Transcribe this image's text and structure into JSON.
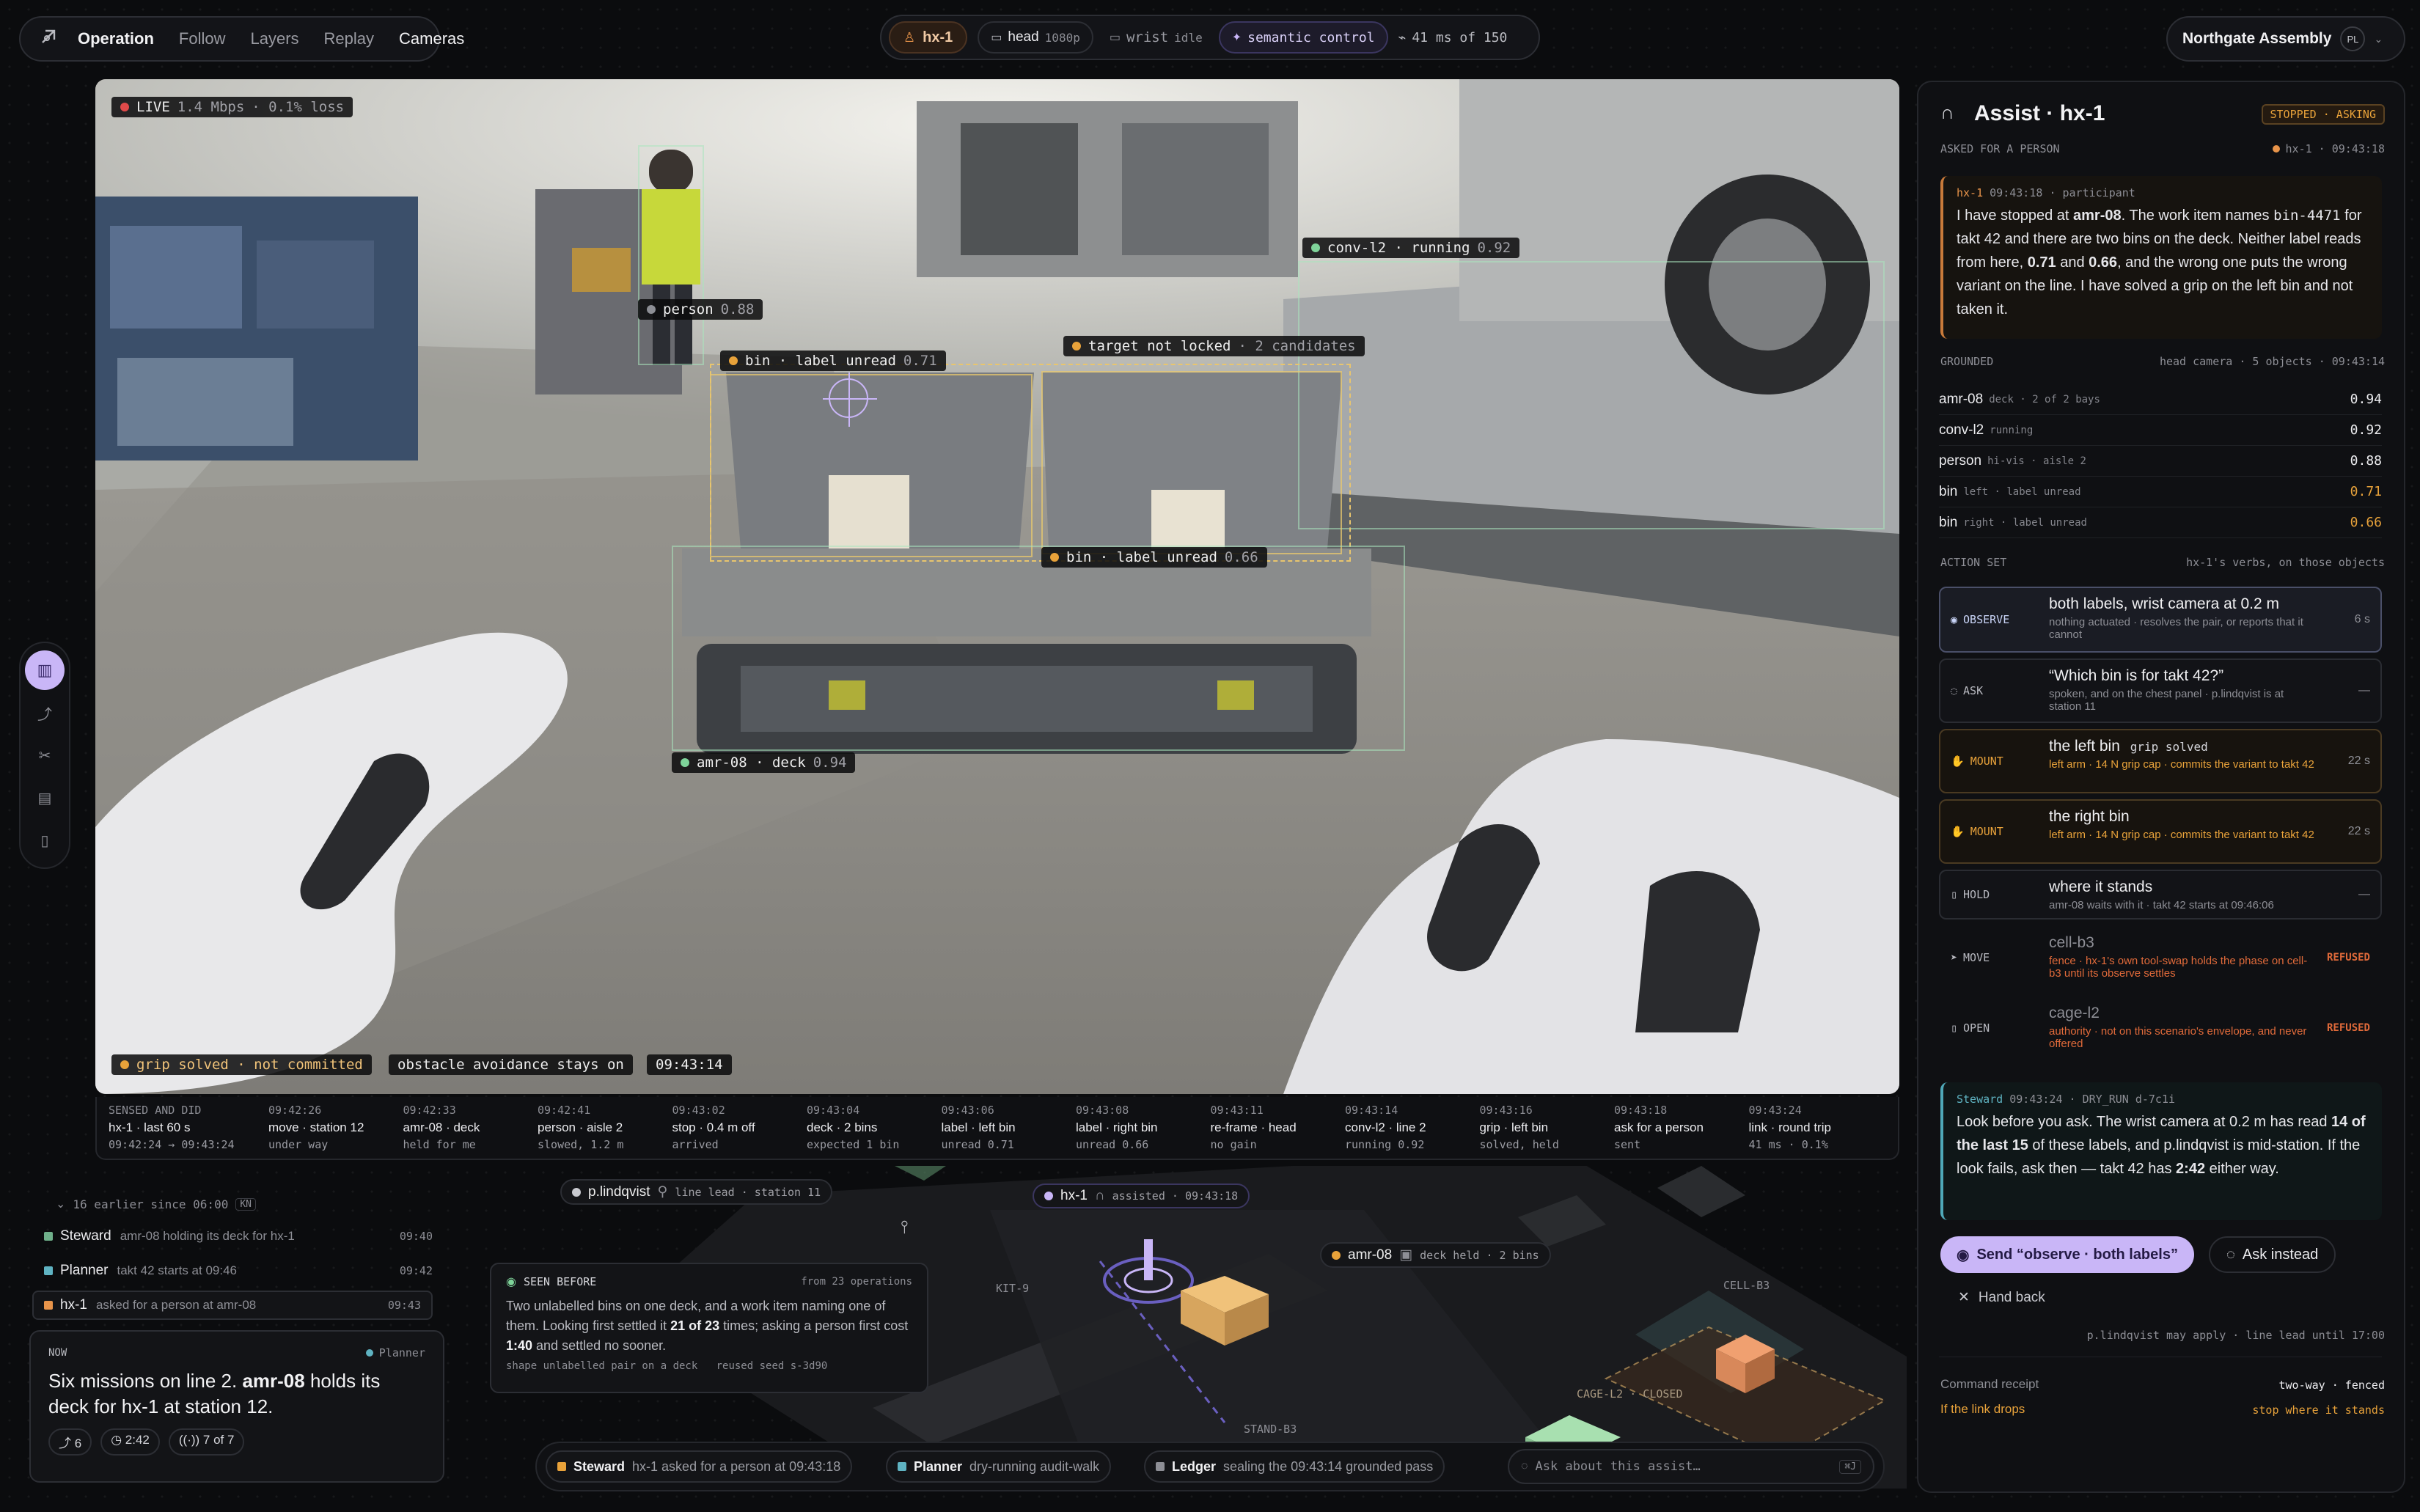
{
  "nav": {
    "items": [
      "Operation",
      "Follow",
      "Layers",
      "Replay",
      "Cameras"
    ]
  },
  "status": {
    "robot": "hx-1",
    "head": "head",
    "head_res": "1080p",
    "wrist": "wrist",
    "wrist_state": "idle",
    "control": "semantic control",
    "latency": "41 ms of 150"
  },
  "org": {
    "name": "Northgate Assembly",
    "initials": "PL"
  },
  "camera": {
    "live": "LIVE",
    "bitrate": "1.4 Mbps",
    "loss": "· 0.1% loss",
    "detections": {
      "person": {
        "label": "person",
        "conf": "0.88"
      },
      "conv": {
        "label": "conv-l2 · running",
        "conf": "0.92"
      },
      "target": {
        "label": "target not locked",
        "note": "· 2 candidates"
      },
      "bin_left": {
        "label": "bin · label unread",
        "conf": "0.71"
      },
      "bin_right": {
        "label": "bin · label unread",
        "conf": "0.66"
      },
      "amr": {
        "label": "amr-08 · deck",
        "conf": "0.94"
      }
    },
    "footer": {
      "grip": "grip solved · not committed",
      "obstacle": "obstacle avoidance stays on",
      "time": "09:43:14"
    }
  },
  "timeline": {
    "head_title": "SENSED AND DID",
    "head_sub": "hx-1 · last 60 s",
    "head_range": "09:42:24 → 09:43:24",
    "events": [
      {
        "t": "09:42:26",
        "a": "move · station 12",
        "b": "under way"
      },
      {
        "t": "09:42:33",
        "a": "amr-08 · deck",
        "b": "held for me"
      },
      {
        "t": "09:42:41",
        "a": "person · aisle 2",
        "b": "slowed, 1.2 m"
      },
      {
        "t": "09:43:02",
        "a": "stop · 0.4 m off",
        "b": "arrived"
      },
      {
        "t": "09:43:04",
        "a": "deck · 2 bins",
        "b": "expected 1 bin"
      },
      {
        "t": "09:43:06",
        "a": "label · left bin",
        "b": "unread 0.71"
      },
      {
        "t": "09:43:08",
        "a": "label · right bin",
        "b": "unread 0.66"
      },
      {
        "t": "09:43:11",
        "a": "re-frame · head",
        "b": "no gain"
      },
      {
        "t": "09:43:14",
        "a": "conv-l2 · line 2",
        "b": "running 0.92"
      },
      {
        "t": "09:43:16",
        "a": "grip · left bin",
        "b": "solved, held"
      },
      {
        "t": "09:43:18",
        "a": "ask for a person",
        "b": "sent"
      },
      {
        "t": "09:43:24",
        "a": "link · round trip",
        "b": "41 ms · 0.1%"
      }
    ]
  },
  "feed": {
    "earlier": "16 earlier since 06:00",
    "shortcut": "KN",
    "items": [
      {
        "who": "Steward",
        "text": "amr-08 holding its deck for hx-1",
        "time": "09:40",
        "color": "#6fb08a"
      },
      {
        "who": "Planner",
        "text": "takt 42 starts at 09:46",
        "time": "09:42",
        "color": "#5fb3c2"
      },
      {
        "who": "hx-1",
        "text": "asked for a person at amr-08",
        "time": "09:43",
        "color": "#e8944a"
      }
    ],
    "now": {
      "label": "NOW",
      "source": "Planner",
      "text_a": "Six missions on line 2. ",
      "bold": "amr-08",
      "text_b": " holds its deck for hx-1 at station 12.",
      "stat1": "6",
      "stat2": "2:42",
      "stat3": "7 of 7"
    }
  },
  "map": {
    "person": {
      "name": "p.lindqvist",
      "role": "line lead · station 11"
    },
    "robot": {
      "name": "hx-1",
      "state": "assisted · 09:43:18"
    },
    "amr": {
      "name": "amr-08",
      "detail": "deck held · 2 bins"
    },
    "zones": {
      "kit": "KIT-9",
      "cell": "CELL-B3",
      "cage": "CAGE-L2 · CLOSED",
      "stand": "STAND-B3"
    },
    "seen": {
      "title": "SEEN BEFORE",
      "from": "from 23 operations",
      "text_a": "Two unlabelled bins on one deck, and a work item naming one of them. Looking first settled it ",
      "b1": "21 of 23",
      "text_b": " times; asking a person first cost ",
      "b2": "1:40",
      "text_c": " and settled no sooner.",
      "shape": "shape unlabelled pair on a deck",
      "reused": "reused seed s-3d90"
    }
  },
  "bottom": {
    "chips": [
      {
        "who": "Steward",
        "text": "hx-1 asked for a person at 09:43:18",
        "color": "#e8a23a"
      },
      {
        "who": "Planner",
        "text": "dry-running audit-walk",
        "color": "#5fb3c2"
      },
      {
        "who": "Ledger",
        "text": "sealing the 09:43:14 grounded pass",
        "color": "#8d8e95"
      }
    ],
    "ask_placeholder": "Ask about this assist…",
    "ask_key": "⌘J"
  },
  "assist": {
    "title": "Assist · hx-1",
    "badge": "STOPPED · ASKING",
    "sub": "ASKED FOR A PERSON",
    "sub_right": "hx-1 · 09:43:18",
    "msg": {
      "who": "hx-1",
      "time": "09:43:18",
      "role": "· participant",
      "t1": "I have stopped at ",
      "b1": "amr-08",
      "t2": ". The work item names ",
      "code": "bin-4471",
      "t3": " for takt 42 and there are two bins on the deck. Neither label reads from here, ",
      "b2": "0.71",
      "t4": " and ",
      "b3": "0.66",
      "t5": ", and the wrong one puts the wrong variant on the line. I have solved a grip on the left bin and not taken it."
    },
    "grounded_title": "GROUNDED",
    "grounded_meta": "head camera · 5 objects · 09:43:14",
    "grounded": [
      {
        "n": "amr-08",
        "d": "deck · 2 of 2 bays",
        "c": "0.94",
        "warn": false
      },
      {
        "n": "conv-l2",
        "d": "running",
        "c": "0.92",
        "warn": false
      },
      {
        "n": "person",
        "d": "hi-vis · aisle 2",
        "c": "0.88",
        "warn": false
      },
      {
        "n": "bin",
        "d": "left · label unread",
        "c": "0.71",
        "warn": true
      },
      {
        "n": "bin",
        "d": "right · label unread",
        "c": "0.66",
        "warn": true
      }
    ],
    "action_title": "ACTION SET",
    "action_meta": "hx-1's verbs, on those objects",
    "actions": [
      {
        "verb": "OBSERVE",
        "head": "both labels, wrist camera at 0.2 m",
        "sub": "nothing actuated · resolves the pair, or reports that it cannot",
        "right": "6 s",
        "kind": "primary"
      },
      {
        "verb": "ASK",
        "head": "“Which bin is for takt 42?”",
        "sub": "spoken, and on the chest panel · p.lindqvist is at station 11",
        "right": "—",
        "kind": "normal"
      },
      {
        "verb": "MOUNT",
        "head": "the left bin",
        "tag": "grip solved",
        "sub": "left arm · 14 N grip cap · commits the variant to takt 42",
        "right": "22 s",
        "kind": "warn"
      },
      {
        "verb": "MOUNT",
        "head": "the right bin",
        "sub": "left arm · 14 N grip cap · commits the variant to takt 42",
        "right": "22 s",
        "kind": "warn"
      },
      {
        "verb": "HOLD",
        "head": "where it stands",
        "sub": "amr-08 waits with it · takt 42 starts at 09:46:06",
        "right": "—",
        "kind": "normal"
      },
      {
        "verb": "MOVE",
        "head": "cell-b3",
        "sub": "fence · hx-1's own tool-swap holds the phase on cell-b3 until its observe settles",
        "right": "REFUSED",
        "kind": "refused"
      },
      {
        "verb": "OPEN",
        "head": "cage-l2",
        "sub": "authority · not on this scenario's envelope, and never offered",
        "right": "REFUSED",
        "kind": "refused"
      }
    ],
    "steward": {
      "who": "Steward",
      "time": "09:43:24",
      "mode": "· DRY_RUN d-7c1i",
      "t1": "Look before you ask. The wrist camera at 0.2 m has read ",
      "b1": "14 of the last 15",
      "t2": " of these labels, and p.lindqvist is mid-station. If the look fails, ask then — takt 42 has ",
      "b2": "2:42",
      "t3": " either way."
    },
    "send": "Send “observe · both labels”",
    "ask_instead": "Ask instead",
    "hand_back": "Hand back",
    "apply_note": "p.lindqvist may apply · line lead until 17:00",
    "receipt_label": "Command receipt",
    "receipt_value": "two-way · fenced",
    "drop_label": "If the link drops",
    "drop_value": "stop where it stands"
  },
  "colors": {
    "accent": "#c9b6f7",
    "warn": "#e8a23a",
    "refused": "#e06a3a",
    "ok": "#7fd49a"
  }
}
